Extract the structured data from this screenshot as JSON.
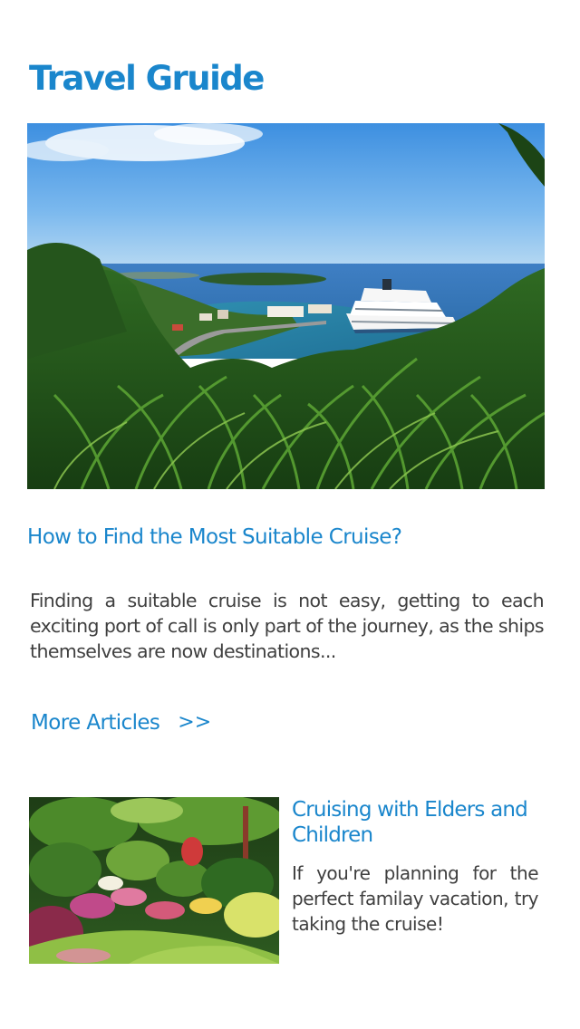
{
  "app": {
    "title": "Travel Gruide"
  },
  "featured": {
    "image_description": "cruise-ship-harbor-photo",
    "title": "How to Find the Most Suitable Cruise?",
    "excerpt": "Finding a suitable cruise is not easy, getting to each exciting port of call is only part of the journey, as the ships themselves are now destinations..."
  },
  "more_articles": {
    "label": "More Articles",
    "arrow": ">>"
  },
  "articles": [
    {
      "image_description": "garden-photo",
      "title": "Cruising with Elders and Children",
      "excerpt": "If you're planning for the perfect familay vacation, try taking the cruise!"
    }
  ],
  "colors": {
    "accent": "#1a86cc",
    "body_text": "#3f3f3f",
    "background": "#ffffff"
  }
}
